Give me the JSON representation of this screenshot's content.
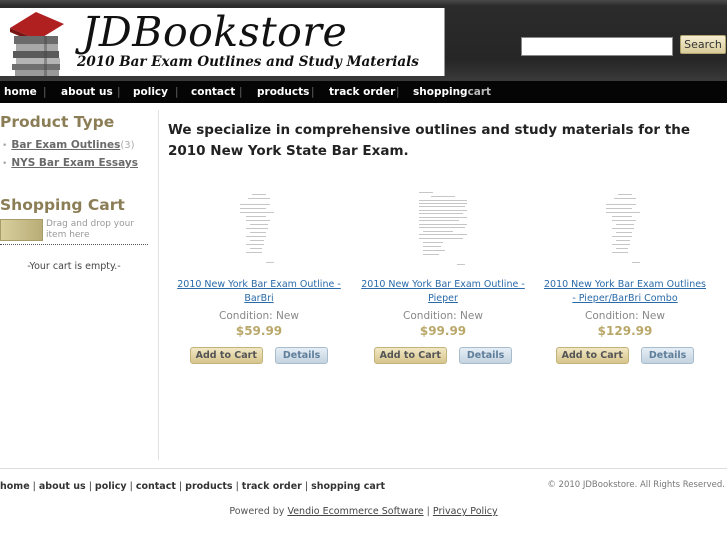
{
  "header": {
    "logo_title": "JDBookstore",
    "logo_tagline": "2010 Bar Exam Outlines and Study Materials",
    "search_placeholder": "",
    "search_button": "Search"
  },
  "nav": {
    "items": [
      "home",
      "about us",
      "policy",
      "contact",
      "products",
      "track order"
    ],
    "cart_part_a": "shopping",
    "cart_part_b": "cart",
    "separator": "|"
  },
  "sidebar": {
    "product_type_heading": "Product Type",
    "categories": [
      {
        "label": "Bar Exam Outlines",
        "count": "(3)"
      },
      {
        "label": "NYS Bar Exam Essays",
        "count": ""
      }
    ],
    "cart_heading": "Shopping Cart",
    "drag_text": "Drag and drop your item here",
    "empty_text": "-Your cart is empty.-"
  },
  "main": {
    "intro": "We specialize in comprehensive outlines and study materials for the 2010 New York State Bar Exam.",
    "products": [
      {
        "title": "2010 New York Bar Exam Outline - BarBri",
        "condition": "Condition: New",
        "price": "$59.99",
        "add": "Add to Cart",
        "details": "Details"
      },
      {
        "title": "2010 New York Bar Exam Outline - Pieper",
        "condition": "Condition: New",
        "price": "$99.99",
        "add": "Add to Cart",
        "details": "Details"
      },
      {
        "title": "2010 New York Bar Exam Outlines - Pieper/BarBri Combo",
        "condition": "Condition: New",
        "price": "$129.99",
        "add": "Add to Cart",
        "details": "Details"
      }
    ]
  },
  "footer": {
    "links": [
      "home",
      "about us",
      "policy",
      "contact",
      "products",
      "track order",
      "shopping cart"
    ],
    "copyright": "© 2010 JDBookstore. All Rights Reserved.",
    "powered_prefix": "Powered by",
    "powered_link": "Vendio Ecommerce Software",
    "powered_sep": "|",
    "privacy_link": "Privacy Policy"
  },
  "colors": {
    "header_bg": "#262626",
    "nav_bg": "#050505",
    "heading_accent": "#8b7d56",
    "link_blue": "#2a6aa8",
    "price": "#b9a86a"
  }
}
